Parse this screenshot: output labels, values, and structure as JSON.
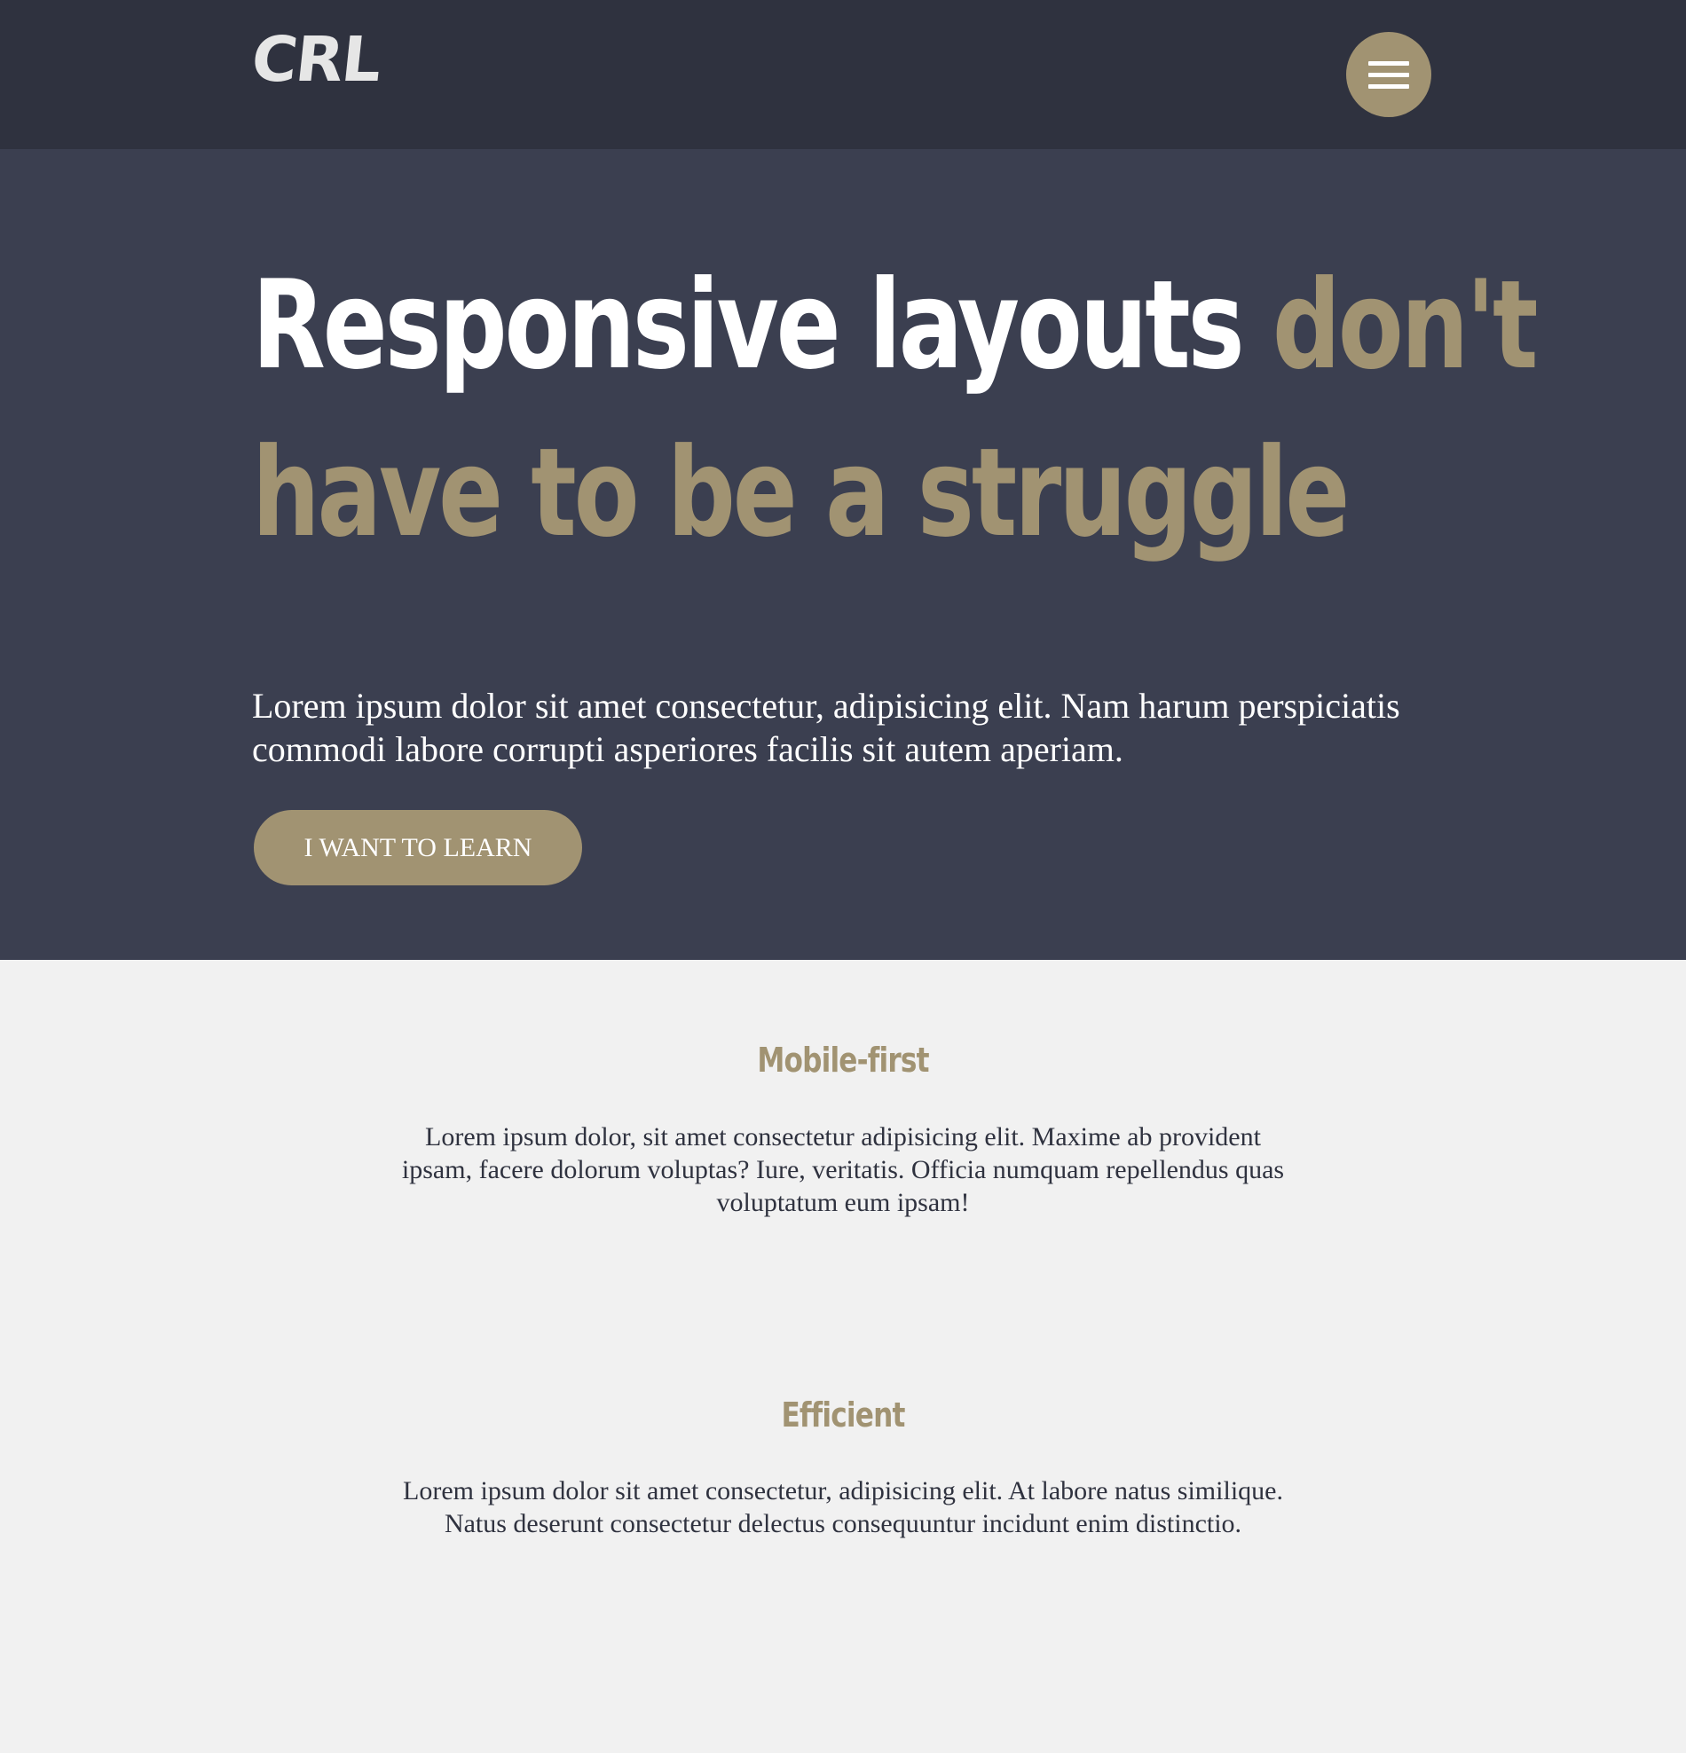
{
  "header": {
    "logo": "CRL",
    "menu_icon": "hamburger-menu-icon"
  },
  "hero": {
    "title_white": "Responsive layouts ",
    "title_accent_line1": "don't",
    "title_accent_line2": "have to be a struggle",
    "body": "Lorem ipsum dolor sit amet consectetur, adipisicing elit. Nam harum perspiciatis commodi labore corrupti asperiores facilis sit autem aperiam.",
    "cta_label": "I WANT TO LEARN"
  },
  "features": [
    {
      "title": "Mobile-first",
      "text": "Lorem ipsum dolor, sit amet consectetur adipisicing elit. Maxime ab provident ipsam, facere dolorum voluptas? Iure, veritatis. Officia numquam repellendus quas voluptatum eum ipsam!"
    },
    {
      "title": "Efficient",
      "text": "Lorem ipsum dolor sit amet consectetur, adipisicing elit. At labore natus similique. Natus deserunt consectetur delectus consequuntur incidunt enim distinctio."
    }
  ],
  "colors": {
    "header_bg": "#2f323f",
    "hero_bg": "#3b3f50",
    "accent": "#a19372",
    "page_bg": "#f1f1f1",
    "body_text": "#2f323f"
  }
}
